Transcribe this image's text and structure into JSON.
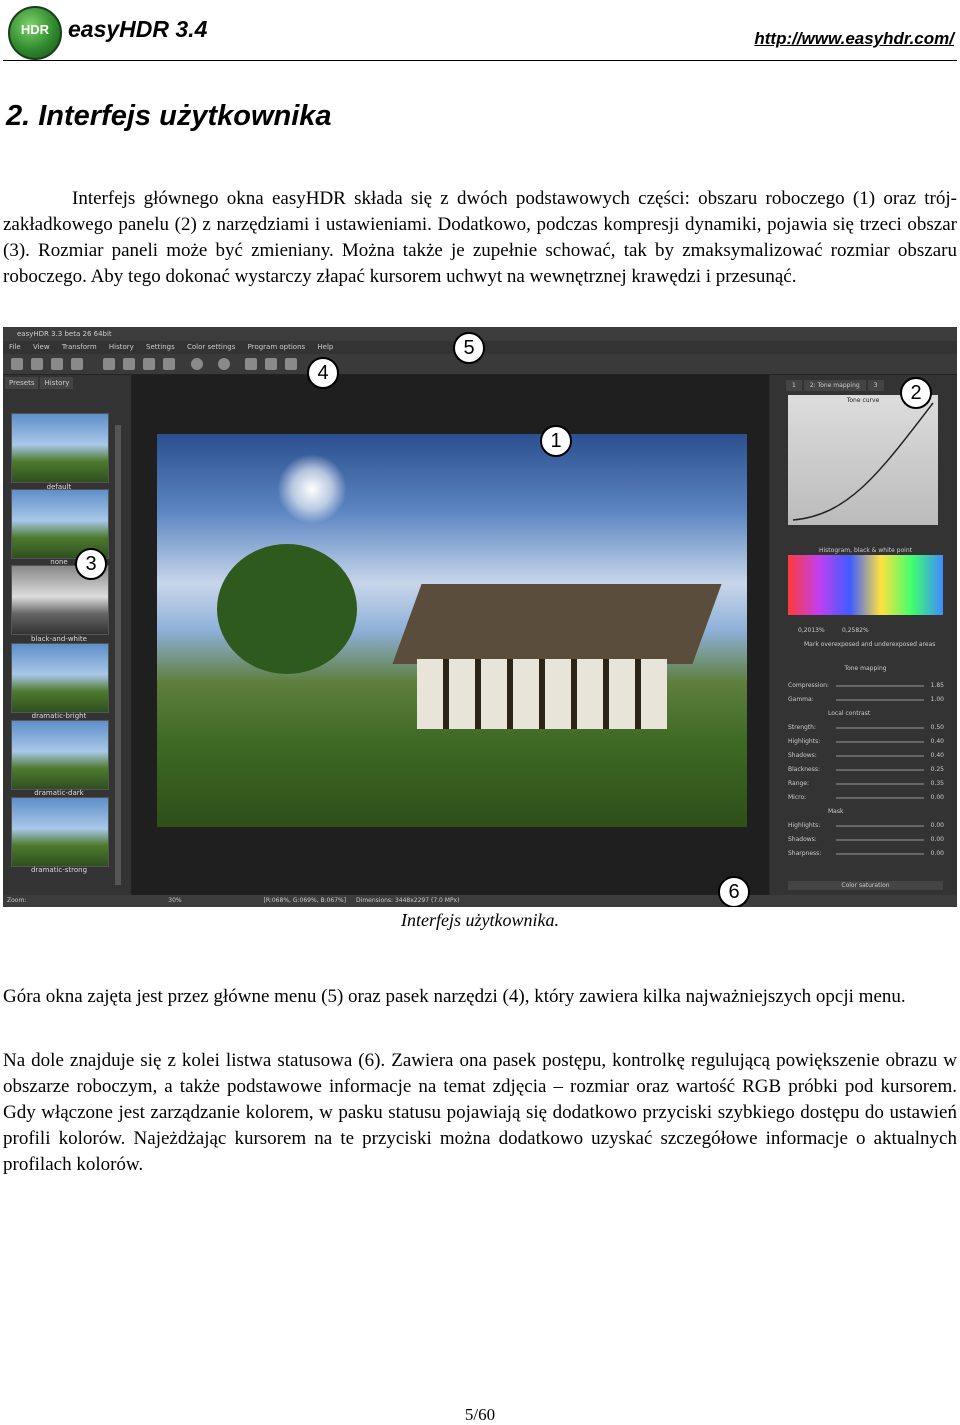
{
  "header": {
    "logo_text": "HDR",
    "brand": "easyHDR 3.4",
    "url": "http://www.easyhdr.com/"
  },
  "section_title": "2. Interfejs użytkownika",
  "paragraphs": {
    "intro": "Interfejs głównego okna easyHDR składa się z dwóch podstawowych części: obszaru roboczego (1) oraz trój-zakładkowego panelu (2) z narzędziami i ustawieniami. Dodatkowo, podczas kompresji dynamiki, pojawia się trzeci obszar (3). Rozmiar paneli może być zmieniany. Można także je zupełnie schować, tak by zmaksymalizować rozmiar obszaru roboczego. Aby tego dokonać wystarczy złapać kursorem uchwyt na wewnętrznej krawędzi i przesunąć.",
    "top": "Góra okna zajęta jest przez główne menu (5) oraz pasek narzędzi (4), który zawiera kilka najważniejszych opcji menu.",
    "bottom": "Na dole znajduje się z kolei listwa statusowa (6). Zawiera ona pasek postępu, kontrolkę regulującą powiększenie obrazu w obszarze roboczym, a także podstawowe informacje na temat zdjęcia – rozmiar oraz wartość RGB próbki pod kursorem. Gdy włączone jest zarządzanie kolorem, w pasku statusu pojawiają się dodatkowo przyciski szybkiego dostępu do ustawień profili kolorów. Najeżdżając kursorem na te przyciski można dodatkowo uzyskać szczegółowe informacje o aktualnych profilach kolorów."
  },
  "screenshot": {
    "window_title": "easyHDR 3.3 beta 26 64bit",
    "menu": [
      "File",
      "View",
      "Transform",
      "History",
      "Settings",
      "Color settings",
      "Program options",
      "Help"
    ],
    "left_tabs": [
      "Presets",
      "History"
    ],
    "presets": [
      "default",
      "none",
      "black-and-white",
      "dramatic-bright",
      "dramatic-dark",
      "dramatic-strong"
    ],
    "right_tabs": [
      "1",
      "2: Tone mapping",
      "3"
    ],
    "tone_curve_label": "Tone curve",
    "histogram_label": "Histogram, black & white point",
    "hist_values": [
      "0,2013%",
      "0,2582%"
    ],
    "mark_over_label": "Mark overexposed and underexposed areas",
    "tone_mapping_label": "Tone mapping",
    "local_contrast_label": "Local contrast",
    "mask_label": "Mask",
    "color_saturation_label": "Color saturation",
    "sliders": [
      {
        "name": "Compression:",
        "value": "1.85"
      },
      {
        "name": "Gamma:",
        "value": "1.00"
      },
      {
        "name": "Strength:",
        "value": "0.50"
      },
      {
        "name": "Highlights:",
        "value": "0.40"
      },
      {
        "name": "Shadows:",
        "value": "0.40"
      },
      {
        "name": "Blackness:",
        "value": "0.25"
      },
      {
        "name": "Range:",
        "value": "0.35"
      },
      {
        "name": "Micro:",
        "value": "0.00"
      },
      {
        "name": "Highlights:",
        "value": "0.00"
      },
      {
        "name": "Shadows:",
        "value": "0.00"
      },
      {
        "name": "Sharpness:",
        "value": "0.00"
      }
    ],
    "status": {
      "zoom_label": "Zoom:",
      "zoom_value": "30%",
      "rgb": "[R:068%, G:069%, B:067%]",
      "dimensions": "Dimensions: 3448x2297 (7.0 MPx)"
    },
    "callouts": [
      "1",
      "2",
      "3",
      "4",
      "5",
      "6"
    ]
  },
  "caption": "Interfejs użytkownika.",
  "page_number": "5/60"
}
